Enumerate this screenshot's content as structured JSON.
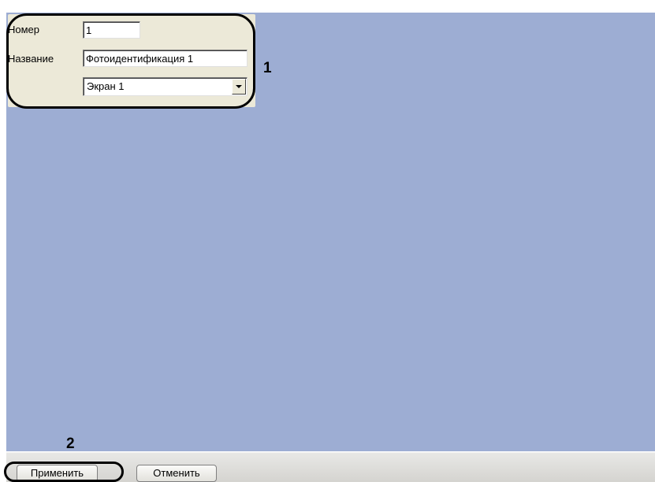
{
  "form": {
    "number_label": "Номер",
    "number_value": "1",
    "name_label": "Название",
    "name_value": "Фотоидентификация 1",
    "screen_value": "Экран 1"
  },
  "callouts": {
    "one": "1",
    "two": "2"
  },
  "footer": {
    "apply_label": "Применить",
    "cancel_label": "Отменить"
  },
  "colors": {
    "panel_background": "#9dadd3",
    "group_background": "#ece9d8"
  }
}
